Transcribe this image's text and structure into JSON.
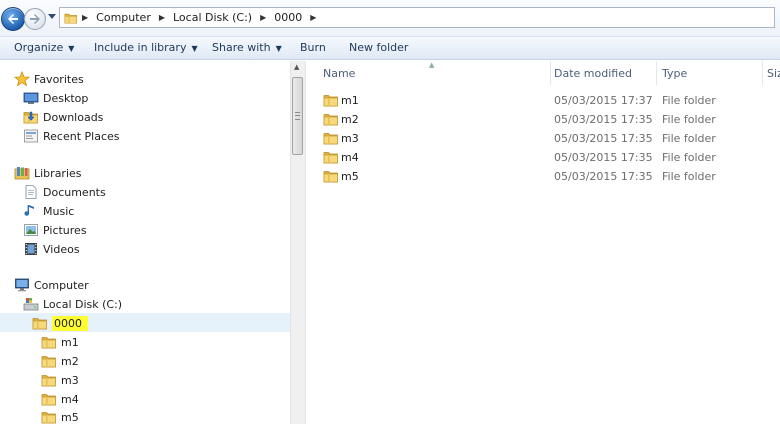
{
  "address": {
    "crumbs": [
      "Computer",
      "Local Disk (C:)",
      "0000"
    ]
  },
  "toolbar": {
    "organize": "Organize",
    "include_in_library": "Include in library",
    "share_with": "Share with",
    "burn": "Burn",
    "new_folder": "New folder"
  },
  "nav": {
    "favorites": {
      "label": "Favorites",
      "items": [
        "Desktop",
        "Downloads",
        "Recent Places"
      ]
    },
    "libraries": {
      "label": "Libraries",
      "items": [
        "Documents",
        "Music",
        "Pictures",
        "Videos"
      ]
    },
    "computer": {
      "label": "Computer",
      "disk": "Local Disk (C:)",
      "selected_folder": "0000",
      "subfolders": [
        "m1",
        "m2",
        "m3",
        "m4",
        "m5"
      ]
    }
  },
  "columns": {
    "name": "Name",
    "date": "Date modified",
    "type": "Type",
    "size": "Siz"
  },
  "files": [
    {
      "name": "m1",
      "date": "05/03/2015 17:37",
      "type": "File folder"
    },
    {
      "name": "m2",
      "date": "05/03/2015 17:35",
      "type": "File folder"
    },
    {
      "name": "m3",
      "date": "05/03/2015 17:35",
      "type": "File folder"
    },
    {
      "name": "m4",
      "date": "05/03/2015 17:35",
      "type": "File folder"
    },
    {
      "name": "m5",
      "date": "05/03/2015 17:35",
      "type": "File folder"
    }
  ],
  "colors": {
    "highlight": "#ffff33",
    "selection": "#e5f1fb",
    "toolbar_text": "#1e395b",
    "secondary_text": "#6d6d6d"
  },
  "icons": [
    "back-arrow-icon",
    "forward-arrow-icon",
    "folder-icon",
    "star-icon",
    "desktop-icon",
    "downloads-icon",
    "recent-places-icon",
    "libraries-icon",
    "documents-icon",
    "music-icon",
    "pictures-icon",
    "videos-icon",
    "computer-icon",
    "disk-icon"
  ]
}
